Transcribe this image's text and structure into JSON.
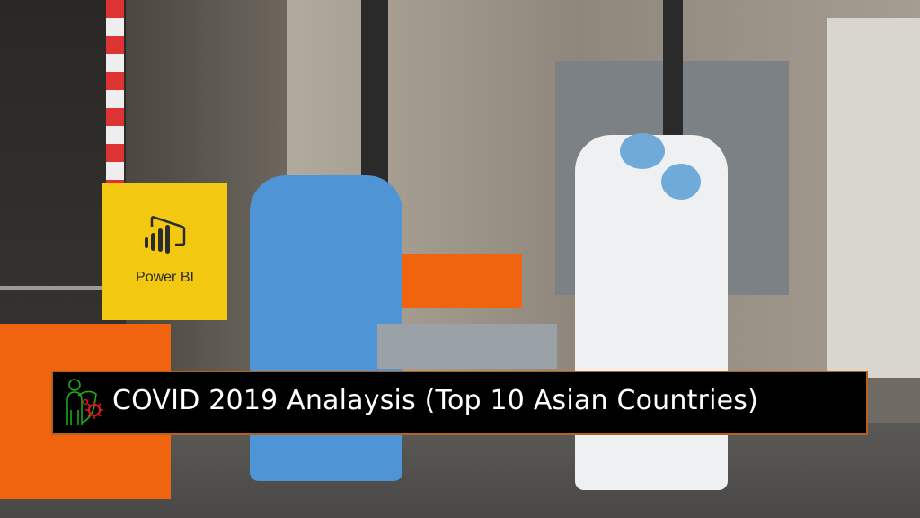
{
  "logo": {
    "label": "Power BI"
  },
  "banner": {
    "title": "COVID 2019 Analaysis (Top 10 Asian Countries)"
  },
  "colors": {
    "powerbi_yellow": "#f2c811",
    "banner_border": "#b5621c",
    "icon_green": "#1db31d",
    "icon_red": "#e01b1b"
  }
}
